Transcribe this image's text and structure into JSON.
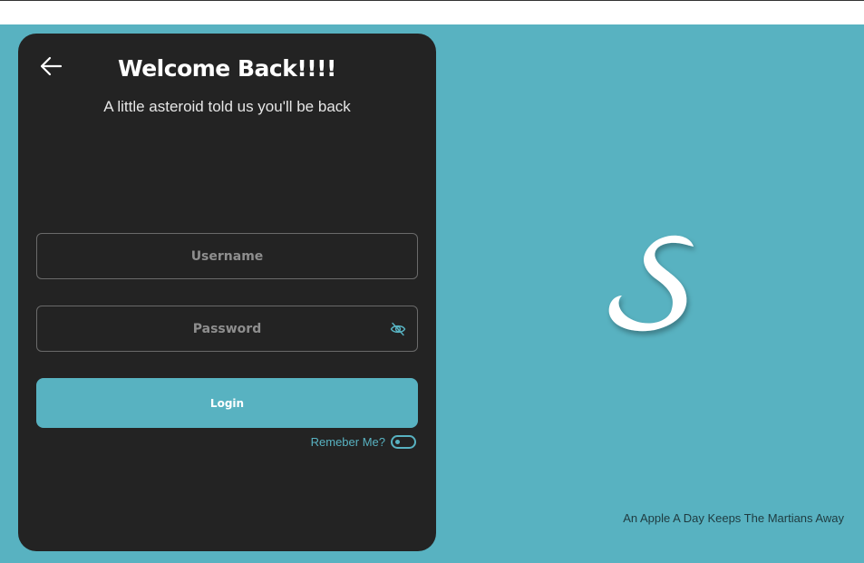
{
  "login_card": {
    "title": "Welcome Back!!!!",
    "subtitle": "A little asteroid told us you'll be back",
    "username": {
      "placeholder": "Username",
      "value": ""
    },
    "password": {
      "placeholder": "Password",
      "value": ""
    },
    "login_label": "Login",
    "remember_label": "Remeber Me?",
    "remember_checked": false
  },
  "branding": {
    "logo_letter": "S",
    "tagline": "An Apple A Day Keeps The Martians Away"
  },
  "icons": {
    "back": "arrow-left-icon",
    "password_visibility": "eye-off-icon"
  },
  "colors": {
    "accent": "#58b2c1",
    "card_background": "#232323",
    "text_primary": "#ffffff"
  }
}
